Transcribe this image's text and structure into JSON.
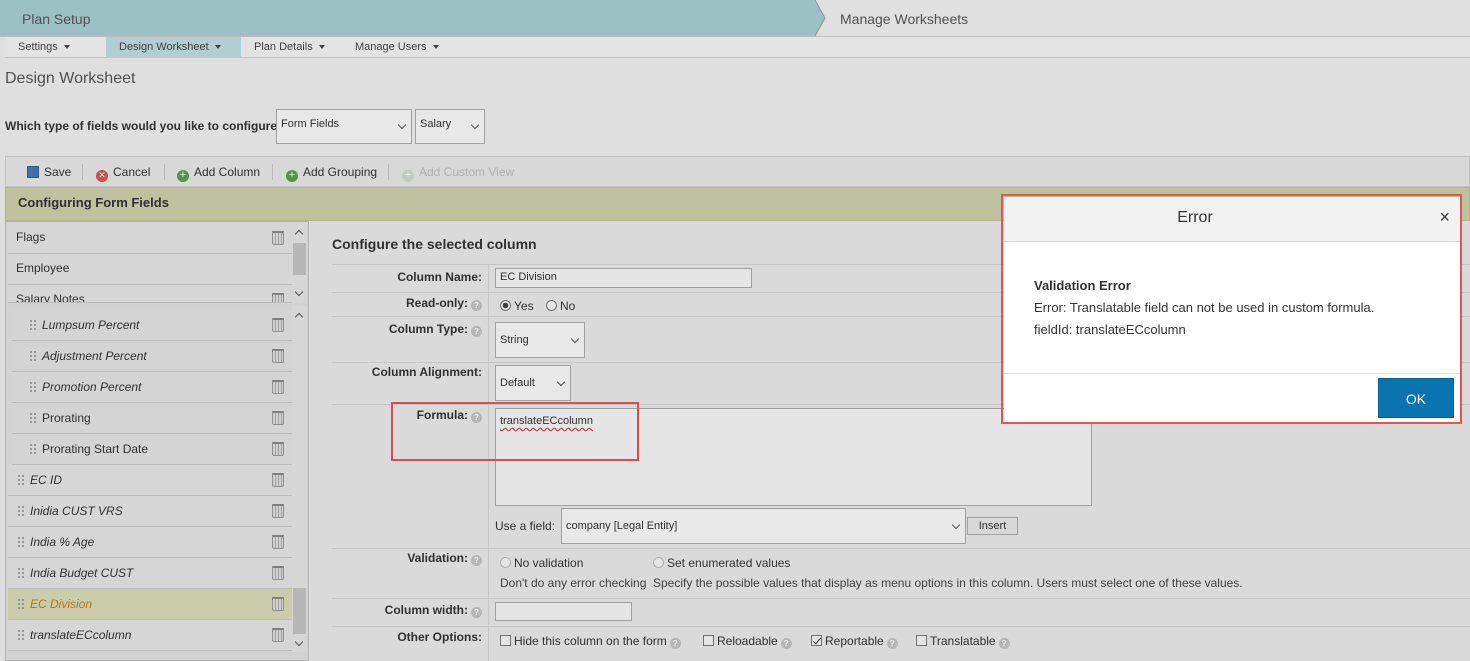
{
  "steps": {
    "step1": "Plan Setup",
    "step2": "Manage Worksheets"
  },
  "menu": [
    "Settings",
    "Design Worksheet",
    "Plan Details",
    "Manage Users"
  ],
  "page_title": "Design Worksheet",
  "question": "Which type of fields would you like to configure:",
  "selects": {
    "field_type": "Form Fields",
    "field_group": "Salary"
  },
  "toolbar": {
    "save": "Save",
    "cancel": "Cancel",
    "add_column": "Add Column",
    "add_grouping": "Add Grouping",
    "add_custom_view": "Add Custom View"
  },
  "config_banner": "Configuring Form Fields",
  "top_list": [
    "Flags",
    "Employee",
    "Salary Notes"
  ],
  "nested_list": [
    "Lumpsum Percent",
    "Adjustment Percent",
    "Promotion Percent",
    "Prorating",
    "Prorating Start Date"
  ],
  "bottom_list": [
    "EC ID",
    "Inidia CUST VRS",
    "India % Age",
    "India Budget CUST",
    "EC Division",
    "translateECcolumn"
  ],
  "selected_item": "EC Division",
  "form": {
    "section_title": "Configure the selected column",
    "column_name_label": "Column Name:",
    "column_name_value": "EC Division",
    "readonly_label": "Read-only:",
    "readonly_yes": "Yes",
    "readonly_no": "No",
    "column_type_label": "Column Type:",
    "column_type_value": "String",
    "alignment_label": "Column Alignment:",
    "alignment_value": "Default",
    "formula_label": "Formula:",
    "formula_value": "translateECcolumn",
    "use_field_label": "Use a field:",
    "use_field_value": "company [Legal Entity]",
    "insert_button": "Insert",
    "validation_label": "Validation:",
    "validation_none": "No validation",
    "validation_none_desc": "Don't do any error checking",
    "validation_enum": "Set enumerated values",
    "validation_enum_desc": "Specify the possible values that display as menu options in this column. Users must select one of these values.",
    "width_label": "Column width:",
    "other_label": "Other Options:",
    "opt_hide": "Hide this column on the form",
    "opt_reloadable": "Reloadable",
    "opt_reportable": "Reportable",
    "opt_translatable": "Translatable"
  },
  "dialog": {
    "title": "Error",
    "close": "×",
    "heading": "Validation Error",
    "line1": "Error: Translatable field can not be used in custom formula.",
    "line2": "fieldId: translateECcolumn",
    "ok": "OK"
  },
  "colors": {
    "step_active": "#a7cdd2",
    "banner": "#cdcfa9",
    "ok_button": "#0a74b1",
    "highlight": "#e05555"
  }
}
